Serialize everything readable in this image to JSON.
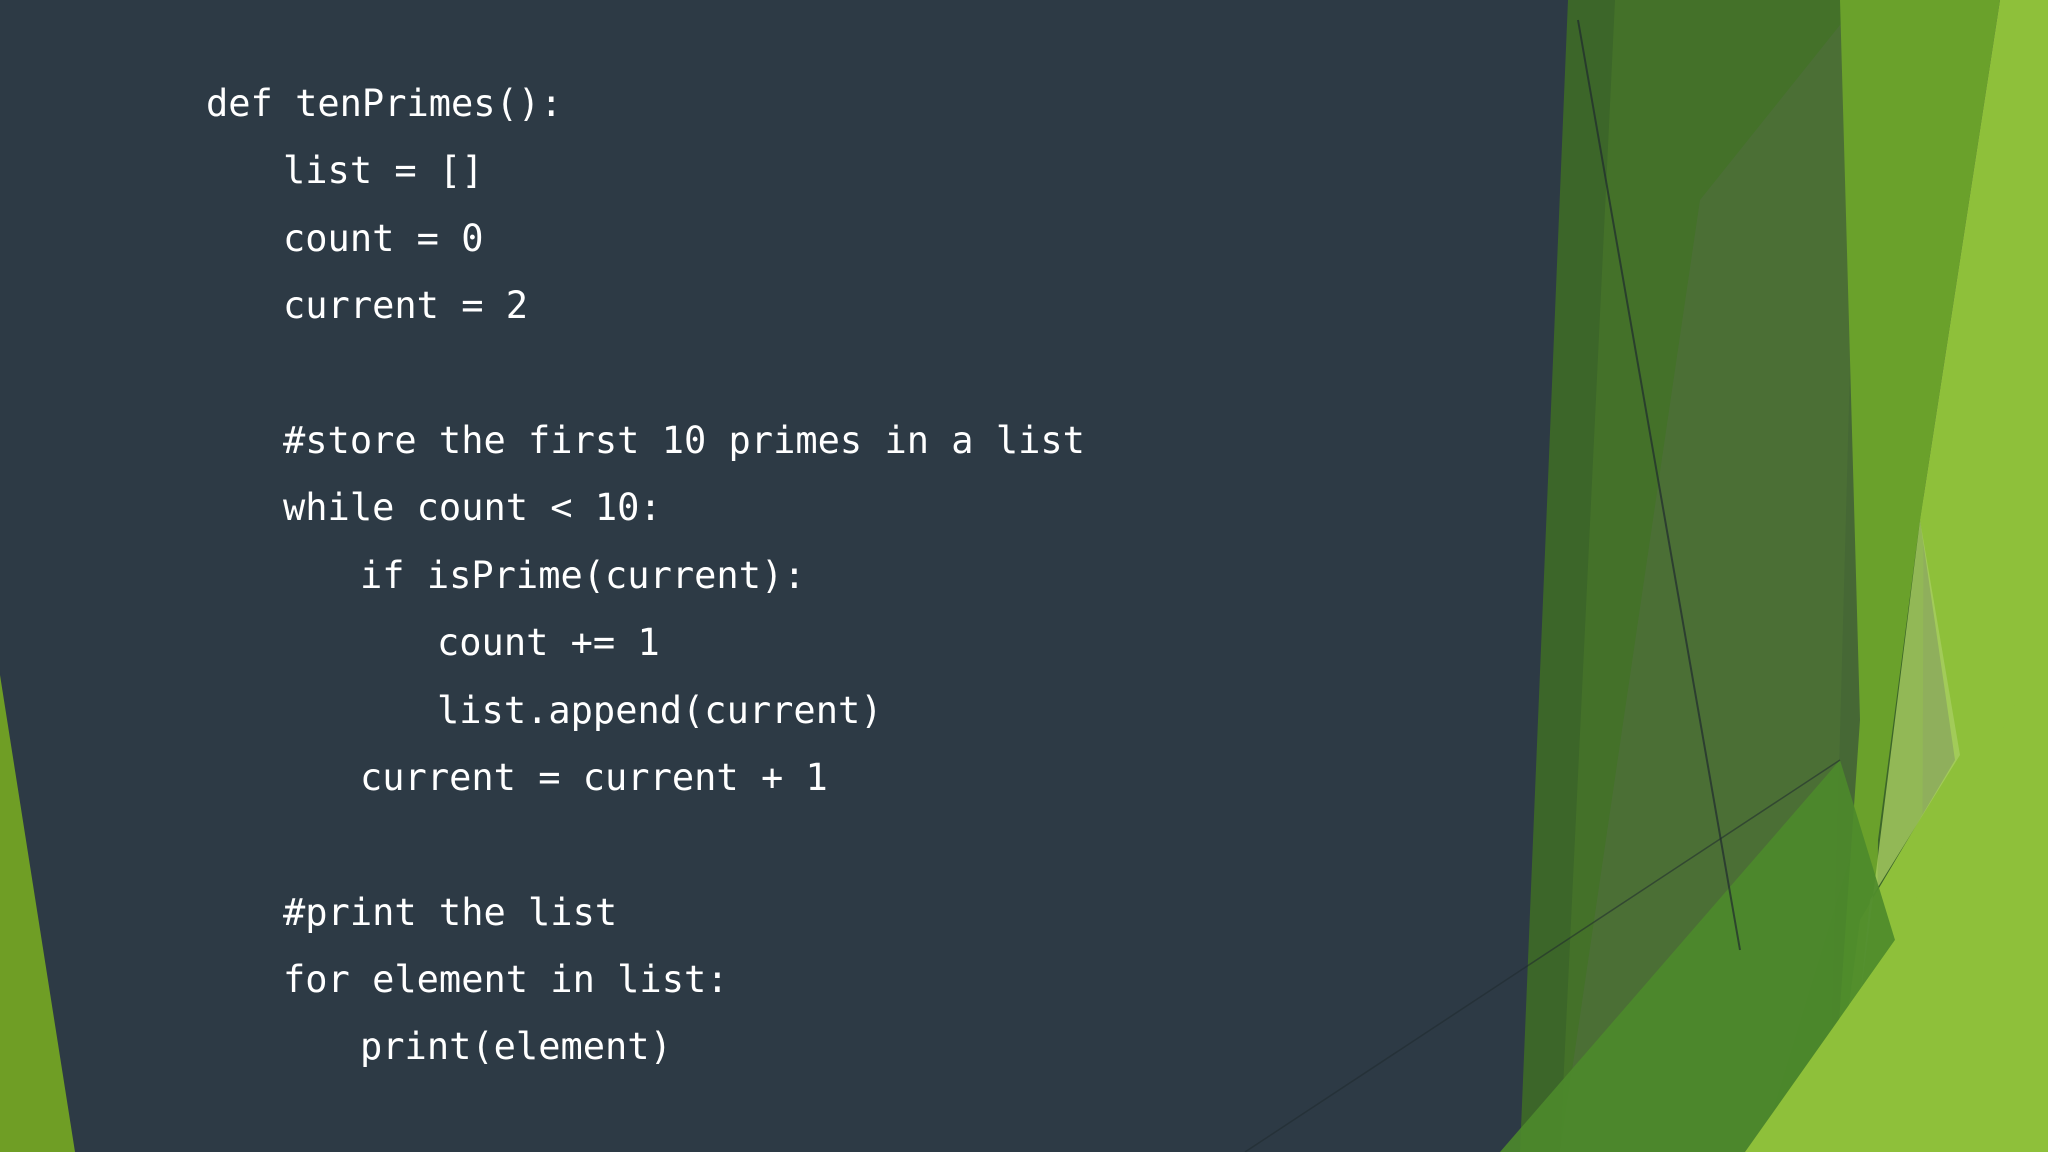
{
  "slide": {
    "background_color": "#2d3a45",
    "accent_colors": [
      "#3f6b26",
      "#4a7a24",
      "#6aa02a",
      "#8dbd38",
      "#a5cc5a"
    ]
  },
  "code": {
    "lines": [
      "def tenPrimes():",
      "list = []",
      "count = 0",
      "current = 2",
      "",
      "#store the first 10 primes in a list",
      "while count < 10:",
      "if isPrime(current):",
      "count += 1",
      "list.append(current)",
      "current = current + 1",
      "",
      "#print the list",
      "for element in list:",
      "print(element)"
    ]
  }
}
